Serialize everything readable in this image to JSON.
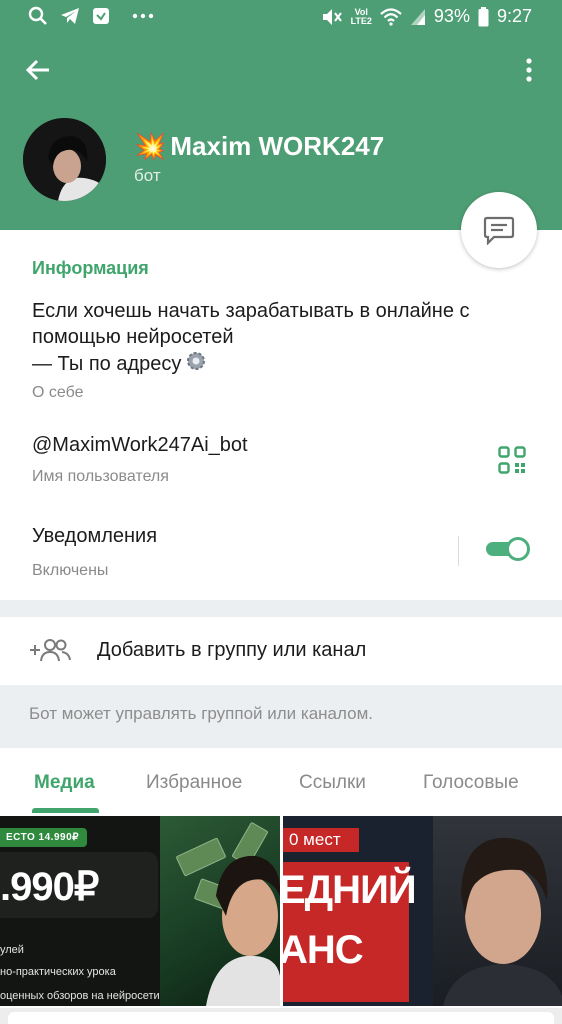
{
  "status_bar": {
    "battery": "93%",
    "time": "9:27",
    "network": "LTE2",
    "volte": "VoI",
    "icons": [
      "search-icon",
      "telegram-icon",
      "shield-icon",
      "more-dots-icon",
      "mute-icon",
      "volte-lte-icon",
      "wifi-icon",
      "signal-icon",
      "battery-icon"
    ]
  },
  "header": {
    "name": "Maxim WORK247",
    "name_emoji": "💥",
    "subtitle": "бот",
    "background": "#4e9e75"
  },
  "info": {
    "section_title": "Информация",
    "about_lines": [
      "Если хочешь начать зарабатывать в онлайне с",
      "помощью нейросетей",
      "— Ты по адресу"
    ],
    "about_caption": "О себе",
    "username": "@MaximWork247Ai_bot",
    "username_caption": "Имя пользователя",
    "notifications_label": "Уведомления",
    "notifications_state": "Включены",
    "notifications_enabled": true
  },
  "actions": {
    "add_to_group": "Добавить в группу или канал",
    "hint": "Бот может управлять группой или каналом."
  },
  "tabs": [
    {
      "label": "Медиа",
      "active": true
    },
    {
      "label": "Избранное",
      "active": false
    },
    {
      "label": "Ссылки",
      "active": false
    },
    {
      "label": "Голосовые",
      "active": false
    }
  ],
  "media": {
    "tile1": {
      "badge": "ЕСТО 14.990₽",
      "price": ".990₽",
      "lines": [
        "улей",
        "но-практических урока",
        "оценных обзоров на нейросети"
      ]
    },
    "tile2": {
      "label": "0 мест",
      "text_lines": [
        "ЕДНИЙ",
        "АНС"
      ]
    }
  },
  "colors": {
    "accent": "#3fa56d",
    "toggle": "#4caf7d"
  }
}
